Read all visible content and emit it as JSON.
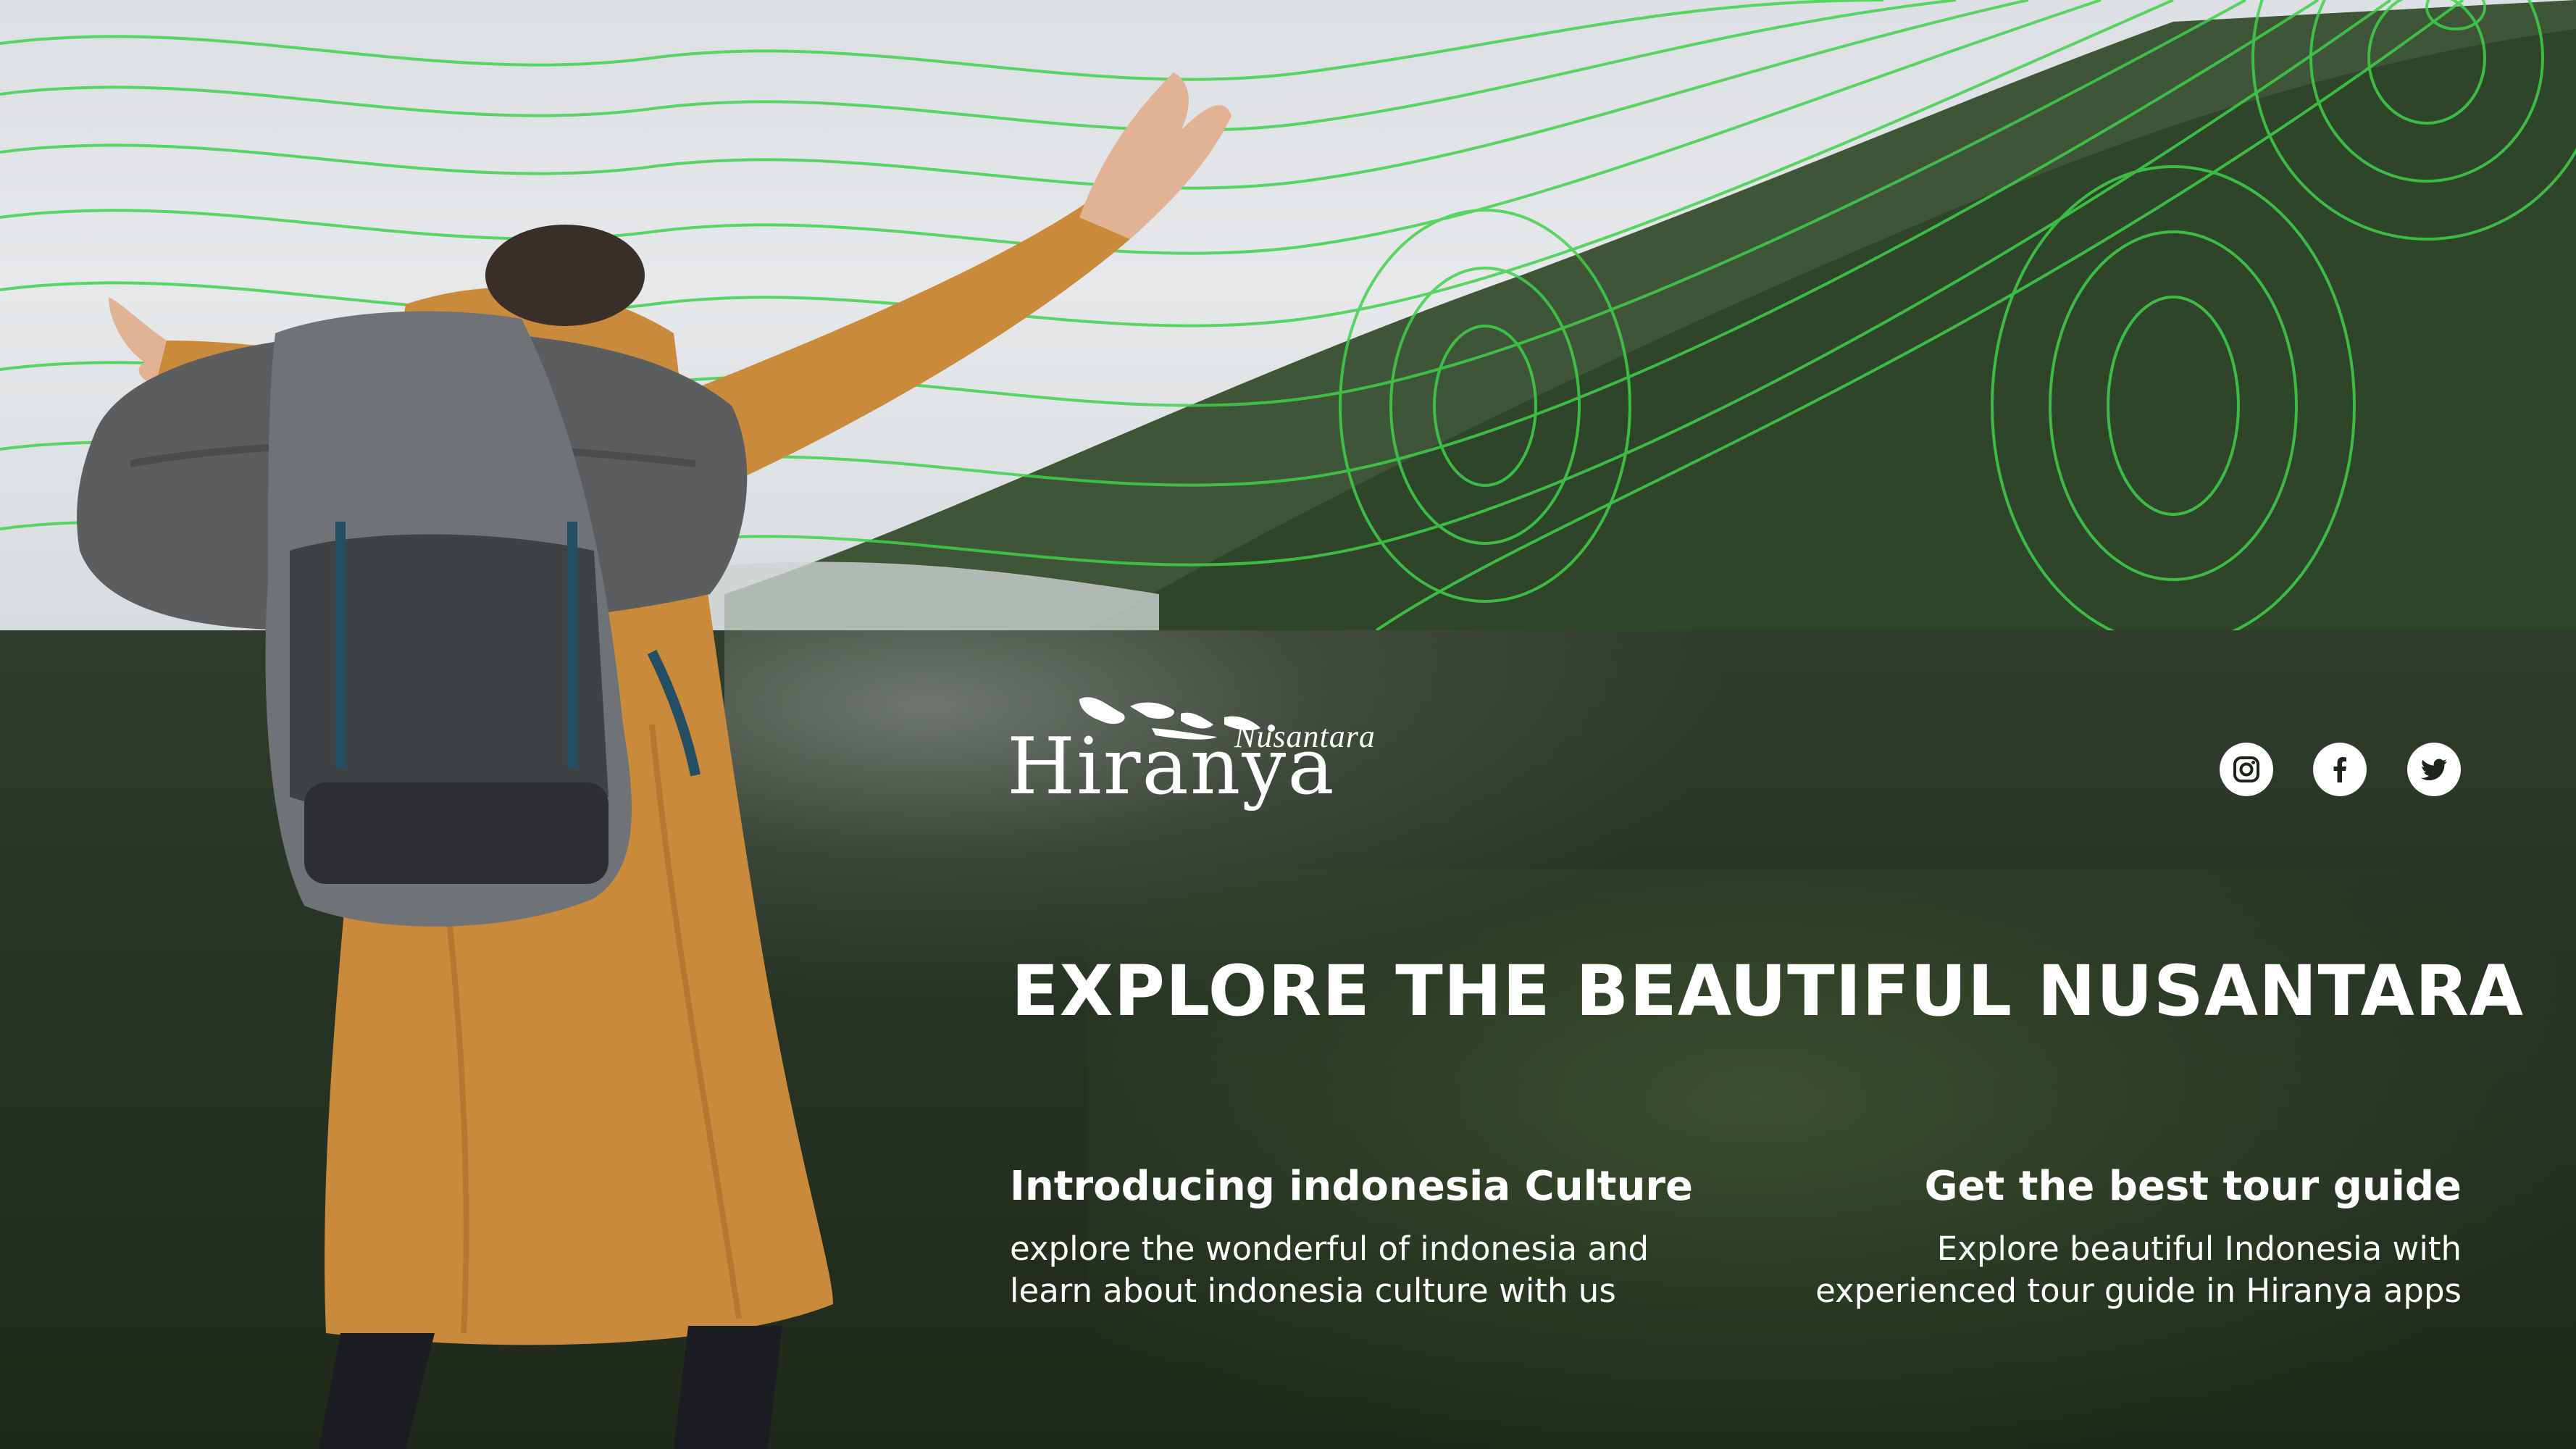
{
  "brand": {
    "name": "Hiranya",
    "subname": "Nusantara"
  },
  "social": {
    "icons": [
      "instagram-icon",
      "facebook-icon",
      "twitter-icon"
    ]
  },
  "headline": "EXPLORE THE BEAUTIFUL NUSANTARA",
  "features": [
    {
      "title": "Introducing indonesia Culture",
      "lines": [
        "explore the wonderful of indonesia and",
        "learn about indonesia culture with us"
      ]
    },
    {
      "title": "Get the best tour guide",
      "lines": [
        "Explore beautiful Indonesia with",
        "experienced tour guide in Hiranya apps"
      ]
    }
  ],
  "colors": {
    "text": "#ffffff",
    "contour": "#3fd14a",
    "forest": "#2c3a28",
    "coat": "#c98a3c"
  }
}
